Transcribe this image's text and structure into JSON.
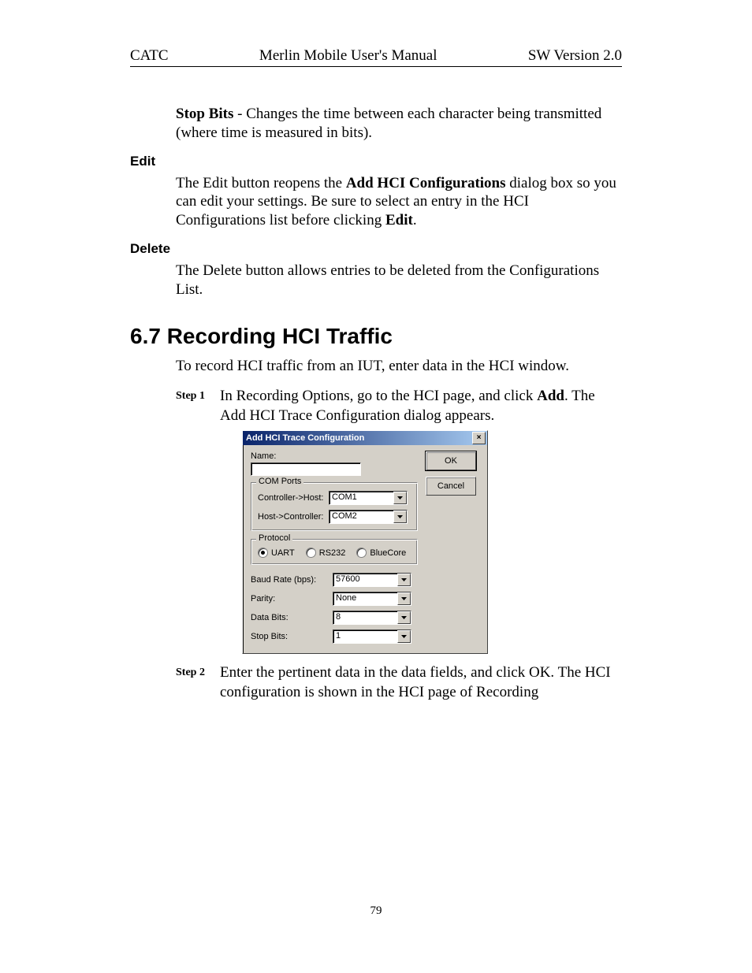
{
  "header": {
    "left": "CATC",
    "center": "Merlin Mobile User's Manual",
    "right": "SW Version 2.0"
  },
  "paragraphs": {
    "stop_bits_bold": "Stop Bits",
    "stop_bits_rest": " - Changes the time between each character being transmitted (where time is measured in bits).",
    "edit_heading": "Edit",
    "edit_p1_a": "The Edit button reopens the ",
    "edit_p1_b_bold": "Add HCI Configurations",
    "edit_p1_c": " dialog box so you can edit your settings.  Be sure to select an entry in the HCI Configurations list before clicking ",
    "edit_p1_d_bold": "Edit",
    "edit_p1_e": ".",
    "delete_heading": "Delete",
    "delete_p": "The Delete button allows entries to be deleted from the Configurations List.",
    "section_heading": "6.7  Recording HCI Traffic",
    "section_intro": "To record HCI traffic from an IUT, enter data in the HCI window.",
    "step1_label": "Step 1",
    "step1_a": "In Recording Options, go to the HCI page, and click ",
    "step1_b_bold": "Add",
    "step1_c": ". The Add HCI Trace Configuration dialog appears.",
    "step2_label": "Step 2",
    "step2_text": "Enter the pertinent data in the data fields, and click OK. The HCI configuration is shown in the HCI page of Recording"
  },
  "dialog": {
    "title": "Add HCI Trace Configuration",
    "close": "×",
    "ok": "OK",
    "cancel": "Cancel",
    "name_label": "Name:",
    "name_value": "",
    "com_ports_group": "COM Ports",
    "controller_host_label": "Controller->Host:",
    "controller_host_value": "COM1",
    "host_controller_label": "Host->Controller:",
    "host_controller_value": "COM2",
    "protocol_group": "Protocol",
    "protocol_options": {
      "uart": "UART",
      "rs232": "RS232",
      "bluecore": "BlueCore"
    },
    "baud_label": "Baud Rate (bps):",
    "baud_value": "57600",
    "parity_label": "Parity:",
    "parity_value": "None",
    "databits_label": "Data Bits:",
    "databits_value": "8",
    "stopbits_label": "Stop Bits:",
    "stopbits_value": "1"
  },
  "page_number": "79"
}
